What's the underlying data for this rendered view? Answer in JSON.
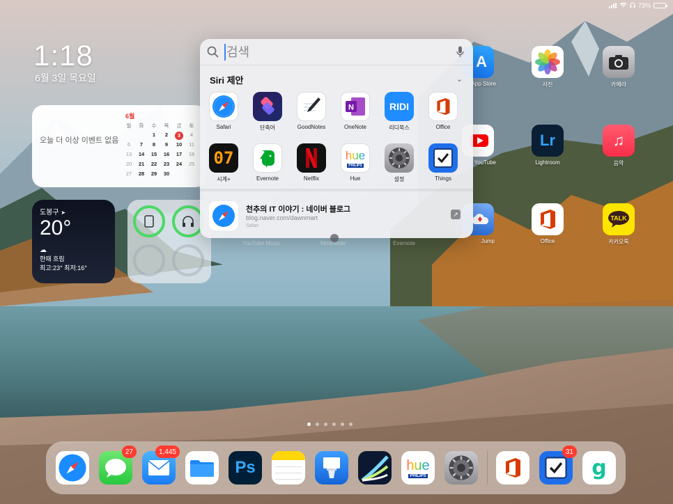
{
  "status_bar": {
    "battery": "73%",
    "battery_level": 0.73
  },
  "clock": {
    "time": "1:18",
    "date": "6월 3일 목요일"
  },
  "calendar_widget": {
    "empty_text": "오늘 더 이상 이벤트 없음",
    "month": "6월",
    "weekdays": [
      "월",
      "화",
      "수",
      "목",
      "금",
      "토"
    ],
    "rows": [
      [
        "",
        "",
        "1",
        "2",
        "3",
        "4"
      ],
      [
        "6",
        "7",
        "8",
        "9",
        "10",
        "11"
      ],
      [
        "13",
        "14",
        "15",
        "16",
        "17",
        "18"
      ],
      [
        "20",
        "21",
        "22",
        "23",
        "24",
        "25"
      ],
      [
        "27",
        "28",
        "29",
        "30",
        "",
        ""
      ]
    ],
    "today": "3"
  },
  "weather_widget": {
    "location": "도봉구",
    "temp": "20°",
    "condition": "한때 흐림",
    "hilo": "최고:23° 최저:16°"
  },
  "home_apps": {
    "app_store": "App Store",
    "photos": "사진",
    "camera": "카메라",
    "youtube": "YouTube",
    "lightroom": "Lightroom",
    "music": "음악",
    "jump": "Jump",
    "office": "Office",
    "kakaotalk": "카카오톡",
    "youtube_music": "YouTube Music",
    "mindnode": "MindNode",
    "evernote_bg": "Evernote"
  },
  "spotlight": {
    "search_placeholder": "검색",
    "section_title": "Siri 제안",
    "apps": [
      {
        "label": "Safari"
      },
      {
        "label": "단축어"
      },
      {
        "label": "GoodNotes"
      },
      {
        "label": "OneNote"
      },
      {
        "label": "리디북스",
        "icon_text": "RIDI"
      },
      {
        "label": "Office"
      },
      {
        "label": "시계+",
        "icon_text": "07"
      },
      {
        "label": "Evernote"
      },
      {
        "label": "Netflix"
      },
      {
        "label": "Hue",
        "icon_text": "hue",
        "sub": "PHILIPS"
      },
      {
        "label": "설정"
      },
      {
        "label": "Things"
      }
    ],
    "result": {
      "title": "천추의 IT 이야기 : 네이버 블로그",
      "url": "blog.naver.com/dawnmart",
      "source": "Safari"
    }
  },
  "dock": {
    "apps": [
      {
        "name": "Safari"
      },
      {
        "name": "Messages",
        "badge": "27"
      },
      {
        "name": "Mail",
        "badge": "1,445"
      },
      {
        "name": "Files"
      },
      {
        "name": "Photoshop",
        "icon_text": "Ps"
      },
      {
        "name": "Notes"
      },
      {
        "name": "Keynote"
      },
      {
        "name": "LumaFusion"
      },
      {
        "name": "Hue",
        "icon_text": "hue",
        "sub": "PHILIPS"
      },
      {
        "name": "Settings"
      },
      {
        "name": "Office"
      },
      {
        "name": "Things",
        "badge": "31"
      },
      {
        "name": "Grammarly",
        "icon_text": "g"
      }
    ]
  },
  "page_indicator": {
    "count": 6,
    "active": 1
  },
  "colors": {
    "accent": "#3b82f6",
    "badge": "#ff3b30",
    "calendar_today": "#e53935",
    "battery_ring": "#4cd964"
  }
}
